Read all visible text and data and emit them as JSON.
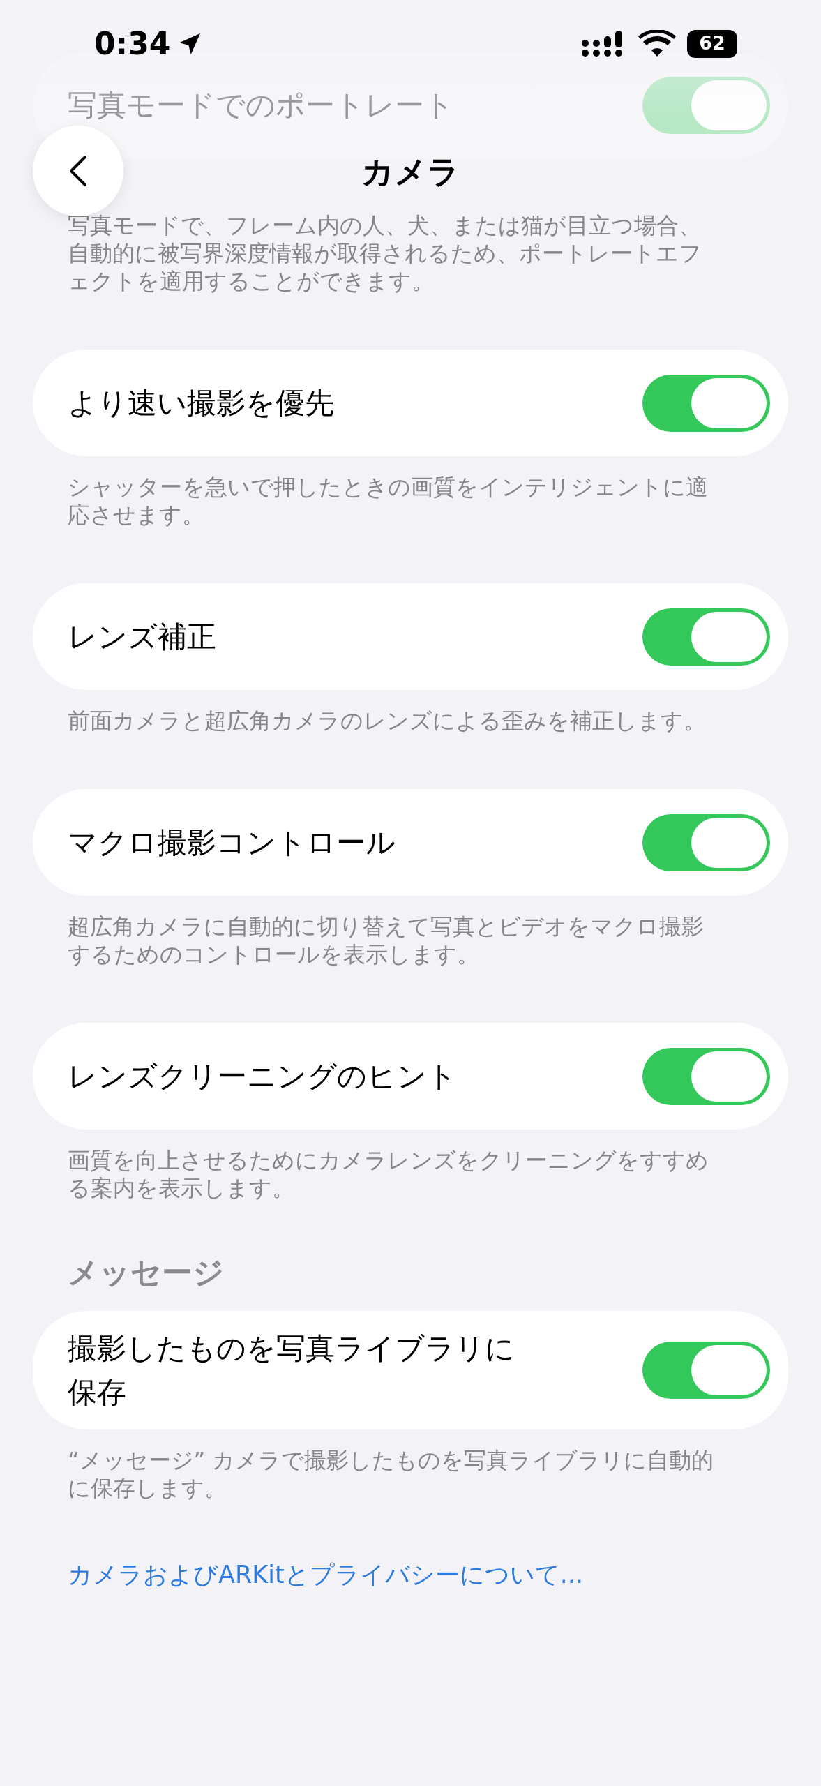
{
  "status_bar": {
    "time": "0:34",
    "battery": "62"
  },
  "nav": {
    "title": "カメラ"
  },
  "groups": [
    {
      "kind": "behind_header",
      "label": "写真モードでのポートレート",
      "on": true,
      "description": "写真モードで、フレーム内の人、犬、または猫が目立つ場合、自動的に被写界深度情報が取得されるため、ポートレートエフェクトを適用することができます。"
    },
    {
      "kind": "row",
      "label": "より速い撮影を優先",
      "on": true,
      "description": "シャッターを急いで押したときの画質をインテリジェントに適応させます。"
    },
    {
      "kind": "row",
      "label": "レンズ補正",
      "on": true,
      "description": "前面カメラと超広角カメラのレンズによる歪みを補正します。"
    },
    {
      "kind": "row",
      "label": "マクロ撮影コントロール",
      "on": true,
      "description": "超広角カメラに自動的に切り替えて写真とビデオをマクロ撮影するためのコントロールを表示します。"
    },
    {
      "kind": "row",
      "label": "レンズクリーニングのヒント",
      "on": true,
      "description": "画質を向上させるためにカメラレンズをクリーニングをすすめる案内を表示します。"
    },
    {
      "kind": "row",
      "header": "メッセージ",
      "label": "撮影したものを写真ライブラリに保存",
      "on": true,
      "description": "“メッセージ” カメラで撮影したものを写真ライブラリに自動的に保存します。"
    }
  ],
  "footer_link": "カメラおよびARKitとプライバシーについて..."
}
